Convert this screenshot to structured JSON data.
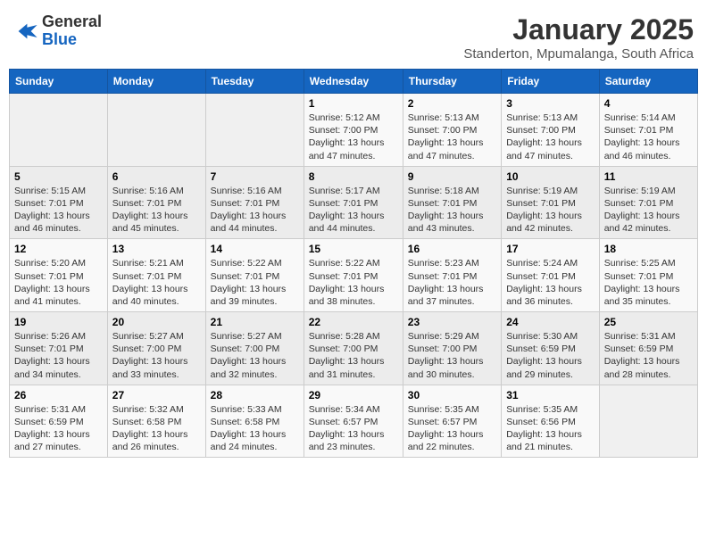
{
  "header": {
    "logo_general": "General",
    "logo_blue": "Blue",
    "month_title": "January 2025",
    "subtitle": "Standerton, Mpumalanga, South Africa"
  },
  "weekdays": [
    "Sunday",
    "Monday",
    "Tuesday",
    "Wednesday",
    "Thursday",
    "Friday",
    "Saturday"
  ],
  "weeks": [
    [
      {
        "day": "",
        "info": ""
      },
      {
        "day": "",
        "info": ""
      },
      {
        "day": "",
        "info": ""
      },
      {
        "day": "1",
        "info": "Sunrise: 5:12 AM\nSunset: 7:00 PM\nDaylight: 13 hours and 47 minutes."
      },
      {
        "day": "2",
        "info": "Sunrise: 5:13 AM\nSunset: 7:00 PM\nDaylight: 13 hours and 47 minutes."
      },
      {
        "day": "3",
        "info": "Sunrise: 5:13 AM\nSunset: 7:00 PM\nDaylight: 13 hours and 47 minutes."
      },
      {
        "day": "4",
        "info": "Sunrise: 5:14 AM\nSunset: 7:01 PM\nDaylight: 13 hours and 46 minutes."
      }
    ],
    [
      {
        "day": "5",
        "info": "Sunrise: 5:15 AM\nSunset: 7:01 PM\nDaylight: 13 hours and 46 minutes."
      },
      {
        "day": "6",
        "info": "Sunrise: 5:16 AM\nSunset: 7:01 PM\nDaylight: 13 hours and 45 minutes."
      },
      {
        "day": "7",
        "info": "Sunrise: 5:16 AM\nSunset: 7:01 PM\nDaylight: 13 hours and 44 minutes."
      },
      {
        "day": "8",
        "info": "Sunrise: 5:17 AM\nSunset: 7:01 PM\nDaylight: 13 hours and 44 minutes."
      },
      {
        "day": "9",
        "info": "Sunrise: 5:18 AM\nSunset: 7:01 PM\nDaylight: 13 hours and 43 minutes."
      },
      {
        "day": "10",
        "info": "Sunrise: 5:19 AM\nSunset: 7:01 PM\nDaylight: 13 hours and 42 minutes."
      },
      {
        "day": "11",
        "info": "Sunrise: 5:19 AM\nSunset: 7:01 PM\nDaylight: 13 hours and 42 minutes."
      }
    ],
    [
      {
        "day": "12",
        "info": "Sunrise: 5:20 AM\nSunset: 7:01 PM\nDaylight: 13 hours and 41 minutes."
      },
      {
        "day": "13",
        "info": "Sunrise: 5:21 AM\nSunset: 7:01 PM\nDaylight: 13 hours and 40 minutes."
      },
      {
        "day": "14",
        "info": "Sunrise: 5:22 AM\nSunset: 7:01 PM\nDaylight: 13 hours and 39 minutes."
      },
      {
        "day": "15",
        "info": "Sunrise: 5:22 AM\nSunset: 7:01 PM\nDaylight: 13 hours and 38 minutes."
      },
      {
        "day": "16",
        "info": "Sunrise: 5:23 AM\nSunset: 7:01 PM\nDaylight: 13 hours and 37 minutes."
      },
      {
        "day": "17",
        "info": "Sunrise: 5:24 AM\nSunset: 7:01 PM\nDaylight: 13 hours and 36 minutes."
      },
      {
        "day": "18",
        "info": "Sunrise: 5:25 AM\nSunset: 7:01 PM\nDaylight: 13 hours and 35 minutes."
      }
    ],
    [
      {
        "day": "19",
        "info": "Sunrise: 5:26 AM\nSunset: 7:01 PM\nDaylight: 13 hours and 34 minutes."
      },
      {
        "day": "20",
        "info": "Sunrise: 5:27 AM\nSunset: 7:00 PM\nDaylight: 13 hours and 33 minutes."
      },
      {
        "day": "21",
        "info": "Sunrise: 5:27 AM\nSunset: 7:00 PM\nDaylight: 13 hours and 32 minutes."
      },
      {
        "day": "22",
        "info": "Sunrise: 5:28 AM\nSunset: 7:00 PM\nDaylight: 13 hours and 31 minutes."
      },
      {
        "day": "23",
        "info": "Sunrise: 5:29 AM\nSunset: 7:00 PM\nDaylight: 13 hours and 30 minutes."
      },
      {
        "day": "24",
        "info": "Sunrise: 5:30 AM\nSunset: 6:59 PM\nDaylight: 13 hours and 29 minutes."
      },
      {
        "day": "25",
        "info": "Sunrise: 5:31 AM\nSunset: 6:59 PM\nDaylight: 13 hours and 28 minutes."
      }
    ],
    [
      {
        "day": "26",
        "info": "Sunrise: 5:31 AM\nSunset: 6:59 PM\nDaylight: 13 hours and 27 minutes."
      },
      {
        "day": "27",
        "info": "Sunrise: 5:32 AM\nSunset: 6:58 PM\nDaylight: 13 hours and 26 minutes."
      },
      {
        "day": "28",
        "info": "Sunrise: 5:33 AM\nSunset: 6:58 PM\nDaylight: 13 hours and 24 minutes."
      },
      {
        "day": "29",
        "info": "Sunrise: 5:34 AM\nSunset: 6:57 PM\nDaylight: 13 hours and 23 minutes."
      },
      {
        "day": "30",
        "info": "Sunrise: 5:35 AM\nSunset: 6:57 PM\nDaylight: 13 hours and 22 minutes."
      },
      {
        "day": "31",
        "info": "Sunrise: 5:35 AM\nSunset: 6:56 PM\nDaylight: 13 hours and 21 minutes."
      },
      {
        "day": "",
        "info": ""
      }
    ]
  ]
}
